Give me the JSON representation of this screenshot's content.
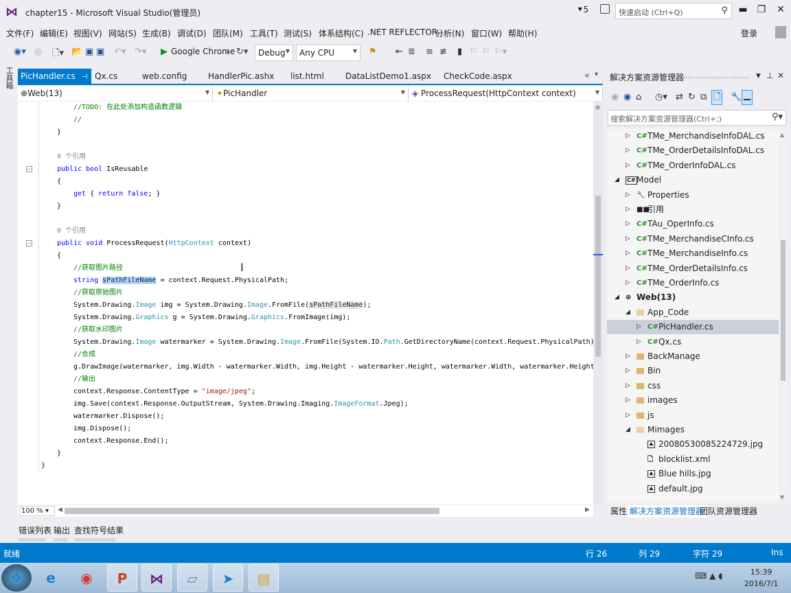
{
  "window": {
    "title": "chapter15 - Microsoft Visual Studio(管理员)",
    "notifications": "5",
    "quick_launch_placeholder": "快速启动 (Ctrl+Q)",
    "login": "登录"
  },
  "menu": [
    "文件(F)",
    "编辑(E)",
    "视图(V)",
    "网站(S)",
    "生成(B)",
    "调试(D)",
    "团队(M)",
    "工具(T)",
    "测试(S)",
    "体系结构(C)",
    ".NET REFLECTOR",
    "分析(N)",
    "窗口(W)",
    "帮助(H)"
  ],
  "toolbar": {
    "run_target": "Google Chrome",
    "configuration": "Debug",
    "platform": "Any CPU"
  },
  "toolbox_label": "工具箱",
  "tabs": [
    {
      "label": "PicHandler.cs",
      "active": true
    },
    {
      "label": "Qx.cs"
    },
    {
      "label": "web.config"
    },
    {
      "label": "HandlerPic.ashx"
    },
    {
      "label": "list.html"
    },
    {
      "label": "DataListDemo1.aspx"
    },
    {
      "label": "CheckCode.aspx"
    }
  ],
  "navbar": {
    "project": "Web(13)",
    "class": "PicHandler",
    "member": "ProcessRequest(HttpContext context)"
  },
  "code": [
    {
      "i": 2,
      "t": [
        [
          "cm",
          "//TODO: 在此处添加构造函数逻辑"
        ]
      ]
    },
    {
      "i": 2,
      "t": [
        [
          "cm",
          "//"
        ]
      ]
    },
    {
      "i": 1,
      "t": [
        [
          "pl",
          "}"
        ]
      ]
    },
    {
      "i": 1,
      "t": []
    },
    {
      "i": 1,
      "t": [
        [
          "lens",
          "0 个引用"
        ]
      ]
    },
    {
      "i": 1,
      "fold": true,
      "t": [
        [
          "kw",
          "public "
        ],
        [
          "kw",
          "bool "
        ],
        [
          "pl",
          "IsReusable"
        ]
      ]
    },
    {
      "i": 1,
      "t": [
        [
          "pl",
          "{"
        ]
      ]
    },
    {
      "i": 2,
      "t": [
        [
          "kw",
          "get "
        ],
        [
          "pl",
          "{ "
        ],
        [
          "kw",
          "return "
        ],
        [
          "kw",
          "false"
        ],
        [
          "pl",
          "; }"
        ]
      ]
    },
    {
      "i": 1,
      "t": [
        [
          "pl",
          "}"
        ]
      ]
    },
    {
      "i": 1,
      "t": []
    },
    {
      "i": 1,
      "t": [
        [
          "lens",
          "0 个引用"
        ]
      ]
    },
    {
      "i": 1,
      "fold": true,
      "t": [
        [
          "kw",
          "public "
        ],
        [
          "kw",
          "void "
        ],
        [
          "pl",
          "ProcessRequest("
        ],
        [
          "ty",
          "HttpContext"
        ],
        [
          "pl",
          " context)"
        ]
      ]
    },
    {
      "i": 1,
      "t": [
        [
          "pl",
          "{"
        ]
      ]
    },
    {
      "i": 2,
      "t": [
        [
          "cm",
          "//获取图片路径"
        ]
      ]
    },
    {
      "i": 2,
      "t": [
        [
          "kw",
          "string "
        ],
        [
          "sel",
          "sPathFileName"
        ],
        [
          "pl",
          " = context.Request.PhysicalPath;"
        ]
      ]
    },
    {
      "i": 2,
      "t": [
        [
          "cm",
          "//获取原始图片"
        ]
      ]
    },
    {
      "i": 2,
      "t": [
        [
          "pl",
          "System.Drawing."
        ],
        [
          "ty",
          "Image"
        ],
        [
          "pl",
          " img = System.Drawing."
        ],
        [
          "ty",
          "Image"
        ],
        [
          "pl",
          ".FromFile("
        ],
        [
          "hl",
          "sPathFileName"
        ],
        [
          "pl",
          ");"
        ]
      ]
    },
    {
      "i": 2,
      "t": [
        [
          "pl",
          "System.Drawing."
        ],
        [
          "ty",
          "Graphics"
        ],
        [
          "pl",
          " g = System.Drawing."
        ],
        [
          "ty",
          "Graphics"
        ],
        [
          "pl",
          ".FromImage(img);"
        ]
      ]
    },
    {
      "i": 2,
      "t": [
        [
          "cm",
          "//获取水印图片"
        ]
      ]
    },
    {
      "i": 2,
      "t": [
        [
          "pl",
          "System.Drawing."
        ],
        [
          "ty",
          "Image"
        ],
        [
          "pl",
          " watermarker = System.Drawing."
        ],
        [
          "ty",
          "Image"
        ],
        [
          "pl",
          ".FromFile(System.IO."
        ],
        [
          "ty",
          "Path"
        ],
        [
          "pl",
          ".GetDirectoryName(context.Request.PhysicalPath) +"
        ]
      ]
    },
    {
      "i": 2,
      "t": [
        [
          "cm",
          "//合成"
        ]
      ]
    },
    {
      "i": 2,
      "t": [
        [
          "pl",
          "g.DrawImage(watermarker, img.Width - watermarker.Width, img.Height - watermarker.Height, watermarker.Width, watermarker.Height);"
        ]
      ]
    },
    {
      "i": 2,
      "t": [
        [
          "cm",
          "//输出"
        ]
      ]
    },
    {
      "i": 2,
      "t": [
        [
          "pl",
          "context.Response.ContentType = "
        ],
        [
          "st",
          "\"image/jpeg\""
        ],
        [
          "pl",
          ";"
        ]
      ]
    },
    {
      "i": 2,
      "t": [
        [
          "pl",
          "img.Save(context.Response.OutputStream, System.Drawing.Imaging."
        ],
        [
          "ty",
          "ImageFormat"
        ],
        [
          "pl",
          ".Jpeg);"
        ]
      ]
    },
    {
      "i": 2,
      "t": [
        [
          "pl",
          "watermarker.Dispose();"
        ]
      ]
    },
    {
      "i": 2,
      "t": [
        [
          "pl",
          "img.Dispose();"
        ]
      ]
    },
    {
      "i": 2,
      "t": [
        [
          "pl",
          "context.Response.End();"
        ]
      ]
    },
    {
      "i": 1,
      "t": [
        [
          "pl",
          "}"
        ]
      ]
    },
    {
      "i": 0,
      "t": [
        [
          "pl",
          "}"
        ]
      ]
    }
  ],
  "editor": {
    "zoom": "100 %"
  },
  "tool_tabs": [
    "错误列表",
    "输出",
    "查找符号结果"
  ],
  "status": {
    "state": "就绪",
    "line": "行 26",
    "col": "列 29",
    "char": "字符 29",
    "mode": "Ins"
  },
  "solution_explorer": {
    "title": "解决方案资源管理器",
    "search_placeholder": "搜索解决方案资源管理器(Ctrl+;)",
    "tree": [
      {
        "label": "TMe_MerchandiseInfoDAL.cs",
        "lvl": 1,
        "exp": "collapsed",
        "icon": "cs"
      },
      {
        "label": "TMe_OrderDetailsInfoDAL.cs",
        "lvl": 1,
        "exp": "collapsed",
        "icon": "cs"
      },
      {
        "label": "TMe_OrderInfoDAL.cs",
        "lvl": 1,
        "exp": "collapsed",
        "icon": "cs"
      },
      {
        "label": "Model",
        "lvl": 0,
        "exp": "expanded",
        "icon": "proj"
      },
      {
        "label": "Properties",
        "lvl": 1,
        "exp": "collapsed",
        "icon": "wrench"
      },
      {
        "label": "引用",
        "lvl": 1,
        "exp": "collapsed",
        "icon": "ref"
      },
      {
        "label": "TAu_OperInfo.cs",
        "lvl": 1,
        "exp": "collapsed",
        "icon": "cs"
      },
      {
        "label": "TMe_MerchandiseCInfo.cs",
        "lvl": 1,
        "exp": "collapsed",
        "icon": "cs"
      },
      {
        "label": "TMe_MerchandiseInfo.cs",
        "lvl": 1,
        "exp": "collapsed",
        "icon": "cs"
      },
      {
        "label": "TMe_OrderDetailsInfo.cs",
        "lvl": 1,
        "exp": "collapsed",
        "icon": "cs"
      },
      {
        "label": "TMe_OrderInfo.cs",
        "lvl": 1,
        "exp": "collapsed",
        "icon": "cs"
      },
      {
        "label": "Web(13)",
        "lvl": 0,
        "exp": "expanded",
        "icon": "web",
        "bold": true
      },
      {
        "label": "App_Code",
        "lvl": 1,
        "exp": "expanded",
        "icon": "folder-open"
      },
      {
        "label": "PicHandler.cs",
        "lvl": 2,
        "exp": "collapsed",
        "icon": "cs",
        "selected": true
      },
      {
        "label": "Qx.cs",
        "lvl": 2,
        "exp": "collapsed",
        "icon": "cs"
      },
      {
        "label": "BackManage",
        "lvl": 1,
        "exp": "collapsed",
        "icon": "folder"
      },
      {
        "label": "Bin",
        "lvl": 1,
        "exp": "collapsed",
        "icon": "folder"
      },
      {
        "label": "css",
        "lvl": 1,
        "exp": "collapsed",
        "icon": "folder"
      },
      {
        "label": "images",
        "lvl": 1,
        "exp": "collapsed",
        "icon": "folder"
      },
      {
        "label": "js",
        "lvl": 1,
        "exp": "collapsed",
        "icon": "folder"
      },
      {
        "label": "Mimages",
        "lvl": 1,
        "exp": "expanded",
        "icon": "folder-open"
      },
      {
        "label": "20080530085224729.jpg",
        "lvl": 2,
        "exp": "none",
        "icon": "image"
      },
      {
        "label": "blocklist.xml",
        "lvl": 2,
        "exp": "none",
        "icon": "xml"
      },
      {
        "label": "Blue hills.jpg",
        "lvl": 2,
        "exp": "none",
        "icon": "image"
      },
      {
        "label": "default.jpg",
        "lvl": 2,
        "exp": "none",
        "icon": "image"
      }
    ],
    "bottom_tabs": [
      {
        "label": "属性"
      },
      {
        "label": "解决方案资源管理器",
        "active": true
      },
      {
        "label": "团队资源管理器"
      }
    ]
  },
  "taskbar": {
    "time": "15:39",
    "date": "2016/7/1"
  },
  "colors": {
    "accent": "#007acc",
    "keyword": "#0000ff",
    "comment": "#008000",
    "type": "#2b91af",
    "string": "#a31515"
  }
}
